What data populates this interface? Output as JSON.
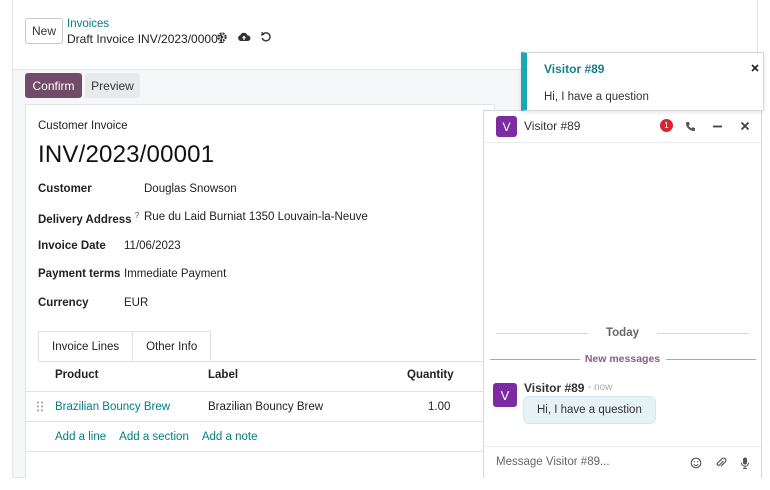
{
  "header": {
    "new_label": "New",
    "breadcrumb": "Invoices",
    "current": "Draft Invoice INV/2023/00001"
  },
  "actions": {
    "confirm": "Confirm",
    "preview": "Preview"
  },
  "form": {
    "doc_type": "Customer Invoice",
    "number": "INV/2023/00001",
    "fields": {
      "customer_label": "Customer",
      "customer_value": "Douglas Snowson",
      "delivery_label": "Delivery Address",
      "delivery_help": "?",
      "delivery_value": "Rue du Laid Burniat 1350 Louvain-la-Neuve",
      "date_label": "Invoice Date",
      "date_value": "11/06/2023",
      "terms_label": "Payment terms",
      "terms_value": "Immediate Payment",
      "currency_label": "Currency",
      "currency_value": "EUR"
    },
    "tabs": [
      "Invoice Lines",
      "Other Info"
    ],
    "columns": {
      "product": "Product",
      "label": "Label",
      "quantity": "Quantity"
    },
    "line": {
      "product": "Brazilian Bouncy Brew",
      "label": "Brazilian Bouncy Brew",
      "quantity": "1.00"
    },
    "add_links": {
      "line": "Add a line",
      "section": "Add a section",
      "note": "Add a note"
    }
  },
  "chat": {
    "avatar_letter": "V",
    "title": "Visitor #89",
    "unread": "1",
    "sep_today": "Today",
    "sep_new": "New messages",
    "message": {
      "author": "Visitor #89",
      "time": "- now",
      "text": "Hi, I have a question"
    },
    "composer_placeholder": "Message Visitor #89..."
  },
  "notification": {
    "title": "Visitor #89",
    "close": "×",
    "body": "Hi, I have a question"
  },
  "colors": {
    "brand": "#714b67",
    "link": "#017e84",
    "avatar": "#7b2ca3",
    "badge": "#d9232e",
    "notif_accent": "#1aa6b3"
  },
  "icons": [
    "gear-icon",
    "cloud-upload-icon",
    "discard-icon",
    "phone-icon",
    "minimize-icon",
    "close-icon",
    "drag-handle-icon",
    "emoji-icon",
    "paperclip-icon",
    "microphone-icon"
  ]
}
